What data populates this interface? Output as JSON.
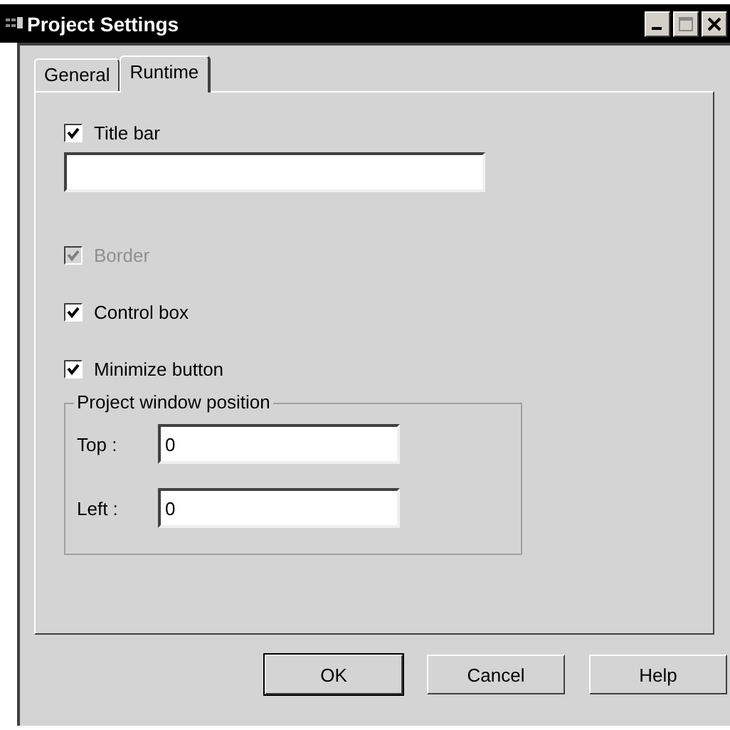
{
  "window": {
    "title": "Project Settings"
  },
  "tabs": [
    {
      "label": "General",
      "selected": false
    },
    {
      "label": "Runtime",
      "selected": true
    }
  ],
  "options": [
    {
      "kind": "checkbox",
      "label": "Title bar",
      "checked": true,
      "disabled": false
    },
    {
      "kind": "field"
    },
    {
      "kind": "checkbox",
      "label": "Border",
      "checked": true,
      "disabled": true
    },
    {
      "kind": "checkbox",
      "label": "Control box",
      "checked": true,
      "disabled": false
    },
    {
      "kind": "checkbox",
      "label": "Minimize button",
      "checked": true,
      "disabled": false
    }
  ],
  "position_group": {
    "title": "Project window position",
    "fields": [
      {
        "label": "Top :",
        "value": "0"
      },
      {
        "label": "Left :",
        "value": "0"
      }
    ]
  },
  "buttons": [
    {
      "label": "OK",
      "default": true
    },
    {
      "label": "Cancel",
      "default": false
    },
    {
      "label": "Help",
      "default": false
    }
  ]
}
